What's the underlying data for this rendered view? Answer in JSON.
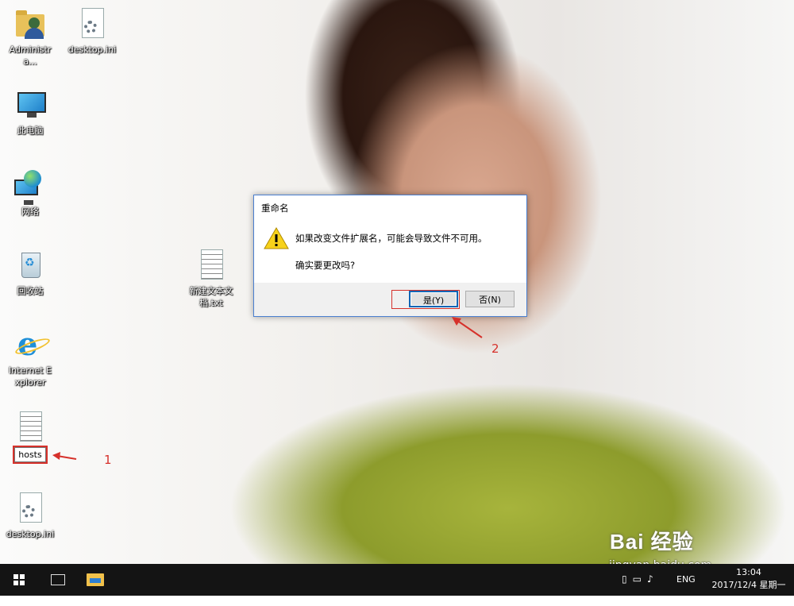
{
  "desktop_icons": [
    {
      "name": "Administra...",
      "icon": "user-folder-icon"
    },
    {
      "name": "desktop.ini",
      "icon": "settings-file-icon"
    },
    {
      "name": "此电脑",
      "icon": "computer-icon"
    },
    {
      "name": "网络",
      "icon": "network-icon"
    },
    {
      "name": "回收站",
      "icon": "recycle-bin-icon"
    },
    {
      "name": "Internet Explorer",
      "icon": "ie-icon"
    },
    {
      "name": "hosts",
      "icon": "text-file-icon"
    },
    {
      "name": "desktop.ini",
      "icon": "settings-file-icon"
    },
    {
      "name": "新建文本文档.txt",
      "icon": "text-file-icon"
    }
  ],
  "annotations": {
    "step1": "1",
    "step2": "2"
  },
  "dialog": {
    "title": "重命名",
    "message": "如果改变文件扩展名，可能会导致文件不可用。",
    "question": "确实要更改吗?",
    "yes_label": "是(Y)",
    "no_label": "否(N)"
  },
  "watermark": {
    "text": "Bai 经验",
    "url": "jingyan.baidu.com"
  },
  "taskbar": {
    "language": "ENG",
    "time": "13:04",
    "date": "2017/12/4 星期一"
  },
  "colors": {
    "annotation_red": "#d6312b",
    "taskbar": "#141414",
    "dialog_border": "#4a7fd0"
  }
}
